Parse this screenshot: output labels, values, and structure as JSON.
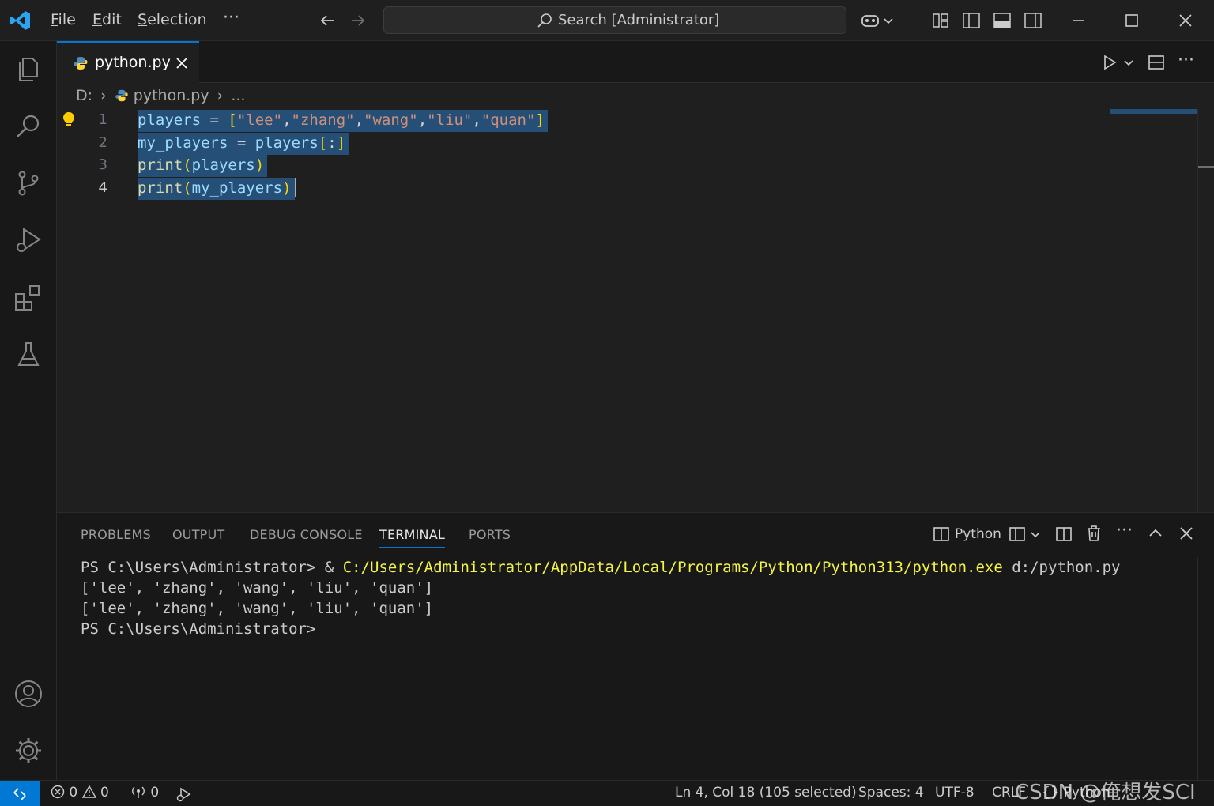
{
  "titlebar": {
    "menu": [
      {
        "label": "File",
        "accel": "F",
        "rest": "ile"
      },
      {
        "label": "Edit",
        "accel": "E",
        "rest": "dit"
      },
      {
        "label": "Selection",
        "accel": "S",
        "rest": "election"
      }
    ],
    "more": "···",
    "search_placeholder": "Search [Administrator]"
  },
  "editor": {
    "tab_label": "python.py",
    "breadcrumb": {
      "drive": "D:",
      "file": "python.py",
      "more": "..."
    },
    "lines": [
      {
        "number": "1",
        "text": "players = [\"lee\",\"zhang\",\"wang\",\"liu\",\"quan\"]"
      },
      {
        "number": "2",
        "text": "my_players = players[:]"
      },
      {
        "number": "3",
        "text": "print(players)"
      },
      {
        "number": "4",
        "text": "print(my_players)"
      }
    ]
  },
  "panel": {
    "tabs": [
      "PROBLEMS",
      "OUTPUT",
      "DEBUG CONSOLE",
      "TERMINAL",
      "PORTS"
    ],
    "active_tab": "TERMINAL",
    "shell_label": "Python",
    "terminal": {
      "prompt1": "PS C:\\Users\\Administrator> & ",
      "cmd_path": "C:/Users/Administrator/AppData/Local/Programs/Python/Python313/python.exe",
      "cmd_arg": " d:/python.py",
      "out1": "['lee', 'zhang', 'wang', 'liu', 'quan']",
      "out2": "['lee', 'zhang', 'wang', 'liu', 'quan']",
      "prompt2": "PS C:\\Users\\Administrator>"
    }
  },
  "statusbar": {
    "errors": "0",
    "warnings": "0",
    "ports": "0",
    "cursor": "Ln 4, Col 18 (105 selected)",
    "spaces": "Spaces: 4",
    "encoding": "UTF-8",
    "eol": "CRLF",
    "language": "Python",
    "watermark": "CSDN @俺想发SCI"
  },
  "colors": {
    "accent": "#0078d4",
    "selection": "#264f78",
    "lightbulb": "#ffcc00"
  }
}
